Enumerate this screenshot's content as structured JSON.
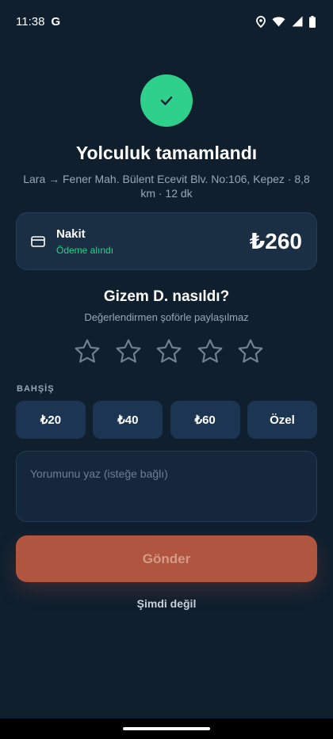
{
  "status_bar": {
    "time": "11:38",
    "g_icon": "G",
    "icons": [
      "location-icon",
      "wifi-icon",
      "signal-icon",
      "battery-icon"
    ]
  },
  "header": {
    "success_icon": "check-icon",
    "title": "Yolculuk tamamlandı",
    "route": "Lara → Fener Mah. Bülent Ecevit Blv. No:106, Kepez · 8,8 km · 12 dk"
  },
  "payment": {
    "icon": "credit-card-icon",
    "method": "Nakit",
    "status": "Ödeme alındı",
    "amount": "₺260"
  },
  "rating": {
    "title": "Gizem D. nasıldı?",
    "subtitle": "Değerlendirmen şoförle paylaşılmaz",
    "max_stars": 5,
    "selected_stars": 0
  },
  "tip": {
    "label": "BAHŞİŞ",
    "options": [
      "₺20",
      "₺40",
      "₺60",
      "Özel"
    ]
  },
  "comment": {
    "placeholder": "Yorumunu yaz (isteğe bağlı)",
    "value": ""
  },
  "actions": {
    "submit_label": "Gönder",
    "later_label": "Şimdi değil"
  },
  "colors": {
    "background": "#0f1f2e",
    "success_green": "#2ed08c",
    "submit_button": "#b0553f",
    "card": "#1a2e44"
  }
}
